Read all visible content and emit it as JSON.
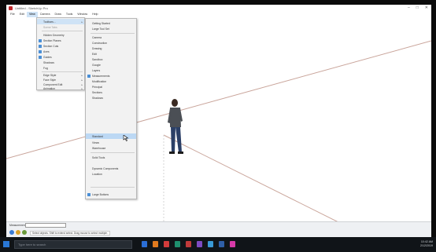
{
  "window": {
    "title": "Untitled - SketchUp Pro",
    "controls": [
      "–",
      "□",
      "✕"
    ]
  },
  "menubar": {
    "items": [
      "File",
      "Edit",
      "View",
      "Camera",
      "Draw",
      "Tools",
      "Window",
      "Help"
    ],
    "active_index": 2
  },
  "view_menu": {
    "items": [
      {
        "label": "Toolbars...",
        "checked": false,
        "arrow": true,
        "highlighted": true,
        "dim": false
      },
      {
        "label": "Scene Tabs",
        "checked": false,
        "arrow": false,
        "highlighted": false,
        "dim": true
      },
      {
        "label": "Hidden Geometry",
        "checked": false,
        "arrow": false,
        "highlighted": false,
        "dim": false
      },
      {
        "label": "Section Planes",
        "checked": true,
        "arrow": false,
        "highlighted": false,
        "dim": false
      },
      {
        "label": "Section Cuts",
        "checked": true,
        "arrow": false,
        "highlighted": false,
        "dim": false
      },
      {
        "label": "Axes",
        "checked": true,
        "arrow": false,
        "highlighted": false,
        "dim": false
      },
      {
        "label": "Guides",
        "checked": true,
        "arrow": false,
        "highlighted": false,
        "dim": false
      },
      {
        "label": "Shadows",
        "checked": false,
        "arrow": false,
        "highlighted": false,
        "dim": false
      },
      {
        "label": "Fog",
        "checked": false,
        "arrow": false,
        "highlighted": false,
        "dim": false
      },
      {
        "label": "Edge Style",
        "checked": false,
        "arrow": true,
        "highlighted": false,
        "dim": false
      },
      {
        "label": "Face Style",
        "checked": false,
        "arrow": true,
        "highlighted": false,
        "dim": false
      },
      {
        "label": "Component Edit",
        "checked": false,
        "arrow": true,
        "highlighted": false,
        "dim": false
      },
      {
        "label": "Animation",
        "checked": false,
        "arrow": true,
        "highlighted": false,
        "dim": false
      }
    ]
  },
  "toolbars_menu": {
    "items": [
      {
        "label": "Getting Started",
        "checked": false,
        "highlighted": false
      },
      {
        "label": "Large Tool Set",
        "checked": false,
        "highlighted": false
      },
      {
        "label": "Camera",
        "checked": false,
        "highlighted": false
      },
      {
        "label": "Construction",
        "checked": false,
        "highlighted": false
      },
      {
        "label": "Drawing",
        "checked": false,
        "highlighted": false
      },
      {
        "label": "Edit",
        "checked": false,
        "highlighted": false
      },
      {
        "label": "Sandbox",
        "checked": false,
        "highlighted": false
      },
      {
        "label": "Google",
        "checked": false,
        "highlighted": false
      },
      {
        "label": "Layers",
        "checked": false,
        "highlighted": false
      },
      {
        "label": "Measurements",
        "checked": true,
        "highlighted": false
      },
      {
        "label": "Modification",
        "checked": false,
        "highlighted": false
      },
      {
        "label": "Principal",
        "checked": false,
        "highlighted": false
      },
      {
        "label": "Sections",
        "checked": false,
        "highlighted": false
      },
      {
        "label": "Shadows",
        "checked": false,
        "highlighted": false
      },
      {
        "label": "Standard",
        "checked": false,
        "highlighted": true
      },
      {
        "label": "Views",
        "checked": false,
        "highlighted": false
      },
      {
        "label": "Warehouse",
        "checked": false,
        "highlighted": false
      },
      {
        "label": "Solid Tools",
        "checked": false,
        "highlighted": false
      },
      {
        "label": "Dynamic Components",
        "checked": false,
        "highlighted": false
      },
      {
        "label": "Location",
        "checked": false,
        "highlighted": false
      },
      {
        "label": "Large Buttons",
        "checked": true,
        "highlighted": false
      }
    ]
  },
  "status": {
    "measurements_label": "Measurements",
    "hint_text": "Select objects. Shift to extend select. Drag mouse to select multiple."
  },
  "taskbar": {
    "search_placeholder": "Type here to search",
    "time": "10:42 AM",
    "date": "2/12/2019"
  },
  "colors": {
    "axis_red": "#c9a49a",
    "axis_green": "#a8c8a0",
    "axis_blue": "#9ab0d0",
    "menu_highlight": "#cfe3f6",
    "check_blue": "#4a8fd6"
  },
  "icons": [
    "sketchup-app-icon",
    "person-figure",
    "pointer-cursor-icon",
    "windows-start-icon",
    "search-icon"
  ]
}
